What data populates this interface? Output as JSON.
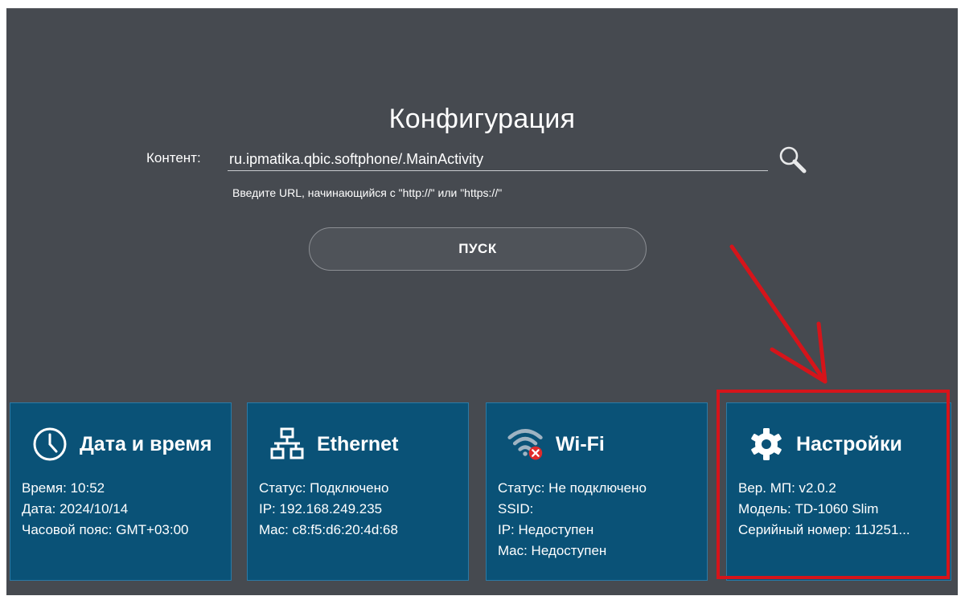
{
  "config": {
    "title": "Конфигурация",
    "content_label": "Контент:",
    "content_value": "ru.ipmatika.qbic.softphone/.MainActivity",
    "hint": "Введите URL, начинающийся с \"http://\" или \"https://\"",
    "start_label": "ПУСК"
  },
  "tiles": {
    "datetime": {
      "title": "Дата и время",
      "icon": "clock-icon",
      "lines": [
        "Время: 10:52",
        "Дата: 2024/10/14",
        "Часовой пояс: GMT+03:00"
      ]
    },
    "ethernet": {
      "title": "Ethernet",
      "icon": "network-icon",
      "lines": [
        "Статус: Подключено",
        "IP: 192.168.249.235",
        "Mac: c8:f5:d6:20:4d:68"
      ]
    },
    "wifi": {
      "title": "Wi-Fi",
      "icon": "wifi-disconnected-icon",
      "lines": [
        "Статус: Не подключено",
        "SSID:",
        "IP: Недоступен",
        "Mac: Недоступен"
      ]
    },
    "settings": {
      "title": "Настройки",
      "icon": "gear-icon",
      "lines": [
        "Вер. МП: v2.0.2",
        "Модель: TD-1060 Slim",
        "Серийный номер: 11J251..."
      ]
    }
  },
  "colors": {
    "background": "#464a50",
    "tile": "#0a5277",
    "annotation": "#d6141a"
  }
}
